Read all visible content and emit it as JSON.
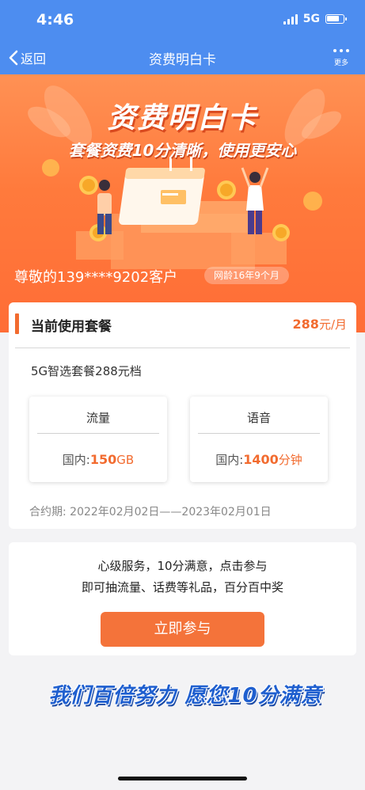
{
  "status_bar": {
    "time": "4:46",
    "network": "5G"
  },
  "nav": {
    "back_label": "返回",
    "title": "资费明白卡",
    "more_label": "更多"
  },
  "banner": {
    "title": "资费明白卡",
    "subtitle": "套餐资费10分清晰，使用更安心",
    "greeting": "尊敬的139****9202客户",
    "network_age": "网龄16年9个月"
  },
  "plan": {
    "header_title": "当前使用套餐",
    "price": "288",
    "price_unit": "元/月",
    "name": "5G智选套餐288元档",
    "data": {
      "label": "流量",
      "prefix": "国内:",
      "value": "150",
      "unit": "GB"
    },
    "voice": {
      "label": "语音",
      "prefix": "国内:",
      "value": "1400",
      "unit": "分钟"
    },
    "contract": "合约期:  2022年02月02日——2023年02月01日"
  },
  "survey": {
    "line1": "心级服务，10分满意，点击参与",
    "line2": "即可抽流量、话费等礼品，百分百中奖",
    "button_label": "立即参与"
  },
  "slogan": "我们百倍努力 愿您10分满意",
  "colors": {
    "brand_blue": "#4d8df0",
    "accent_orange": "#f26b2f",
    "button_orange": "#f4733a"
  }
}
